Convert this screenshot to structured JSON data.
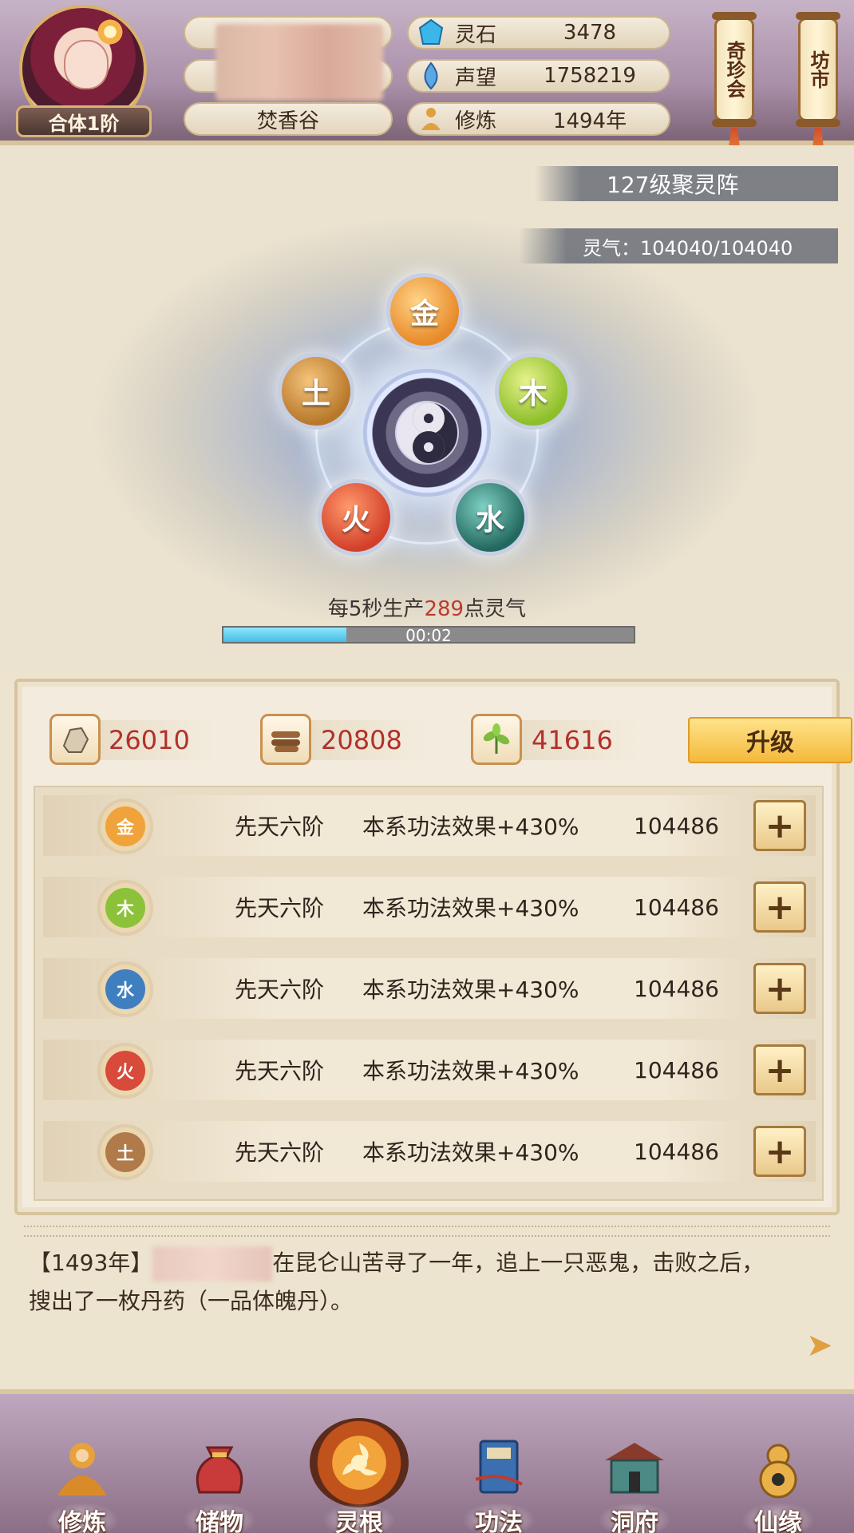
{
  "player": {
    "realm": "合体1阶",
    "sect": "焚香谷"
  },
  "resources": [
    {
      "icon": "spirit-stone-icon",
      "label": "灵石",
      "value": "3478"
    },
    {
      "icon": "prestige-icon",
      "label": "声望",
      "value": "1758219"
    },
    {
      "icon": "cultivation-icon",
      "label": "修炼",
      "value": "1494年"
    }
  ],
  "side_buttons": {
    "treasure_auction": "奇珍会",
    "market": "坊市"
  },
  "array": {
    "level_title": "127级聚灵阵",
    "qi_label": "灵气：104040/104040",
    "produce_prefix": "每5秒生产",
    "produce_amount": "289",
    "produce_suffix": "点灵气",
    "timer": "00:02",
    "progress": 0.3,
    "elements": {
      "metal": "金",
      "wood": "木",
      "water": "水",
      "fire": "火",
      "earth": "土"
    }
  },
  "upgrade": {
    "costs": [
      {
        "icon": "ore-icon",
        "value": "26010"
      },
      {
        "icon": "wood-icon",
        "value": "20808"
      },
      {
        "icon": "herb-icon",
        "value": "41616"
      }
    ],
    "button_label": "升级"
  },
  "element_rows": [
    {
      "element": "金",
      "color": "#f0a33a",
      "stage": "先天六阶",
      "effect": "本系功法效果+430%",
      "value": "104486"
    },
    {
      "element": "木",
      "color": "#8cc23a",
      "stage": "先天六阶",
      "effect": "本系功法效果+430%",
      "value": "104486"
    },
    {
      "element": "水",
      "color": "#3f7fc0",
      "stage": "先天六阶",
      "effect": "本系功法效果+430%",
      "value": "104486"
    },
    {
      "element": "火",
      "color": "#d84a3a",
      "stage": "先天六阶",
      "effect": "本系功法效果+430%",
      "value": "104486"
    },
    {
      "element": "土",
      "color": "#b07a4a",
      "stage": "先天六阶",
      "effect": "本系功法效果+430%",
      "value": "104486"
    }
  ],
  "log": {
    "year": "【1493年】",
    "text_after": "在昆仑山苦寻了一年，追上一只恶鬼，击败之后，",
    "line2": "搜出了一枚丹药（一品体魄丹）。"
  },
  "nav": [
    {
      "label": "修炼",
      "icon": "meditating-monk-icon"
    },
    {
      "label": "储物",
      "icon": "storage-bag-icon"
    },
    {
      "label": "灵根",
      "icon": "spirit-root-icon",
      "active": true
    },
    {
      "label": "功法",
      "icon": "technique-book-icon"
    },
    {
      "label": "洞府",
      "icon": "cave-dwelling-icon"
    },
    {
      "label": "仙缘",
      "icon": "gourd-icon"
    }
  ]
}
